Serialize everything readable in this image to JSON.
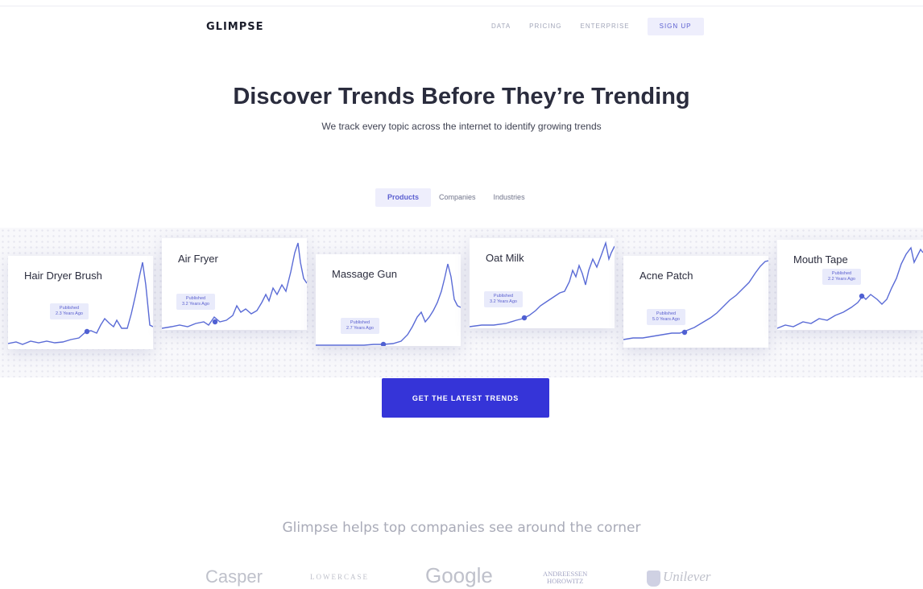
{
  "header": {
    "logo": "GLIMPSE",
    "nav": [
      "DATA",
      "PRICING",
      "ENTERPRISE"
    ],
    "signup_label": "SIGN UP"
  },
  "hero": {
    "title": "Discover Trends Before They’re Trending",
    "subtitle": "We track every topic across the internet to identify growing trends"
  },
  "tabs": {
    "items": [
      "Products",
      "Companies",
      "Industries"
    ],
    "active": "Products"
  },
  "cards": [
    {
      "name": "Hair Dryer Brush",
      "published_line1": "Published",
      "published_line2": "2.3 Years Ago"
    },
    {
      "name": "Air Fryer",
      "published_line1": "Published",
      "published_line2": "3.2 Years Ago"
    },
    {
      "name": "Massage Gun",
      "published_line1": "Published",
      "published_line2": "2.7 Years Ago"
    },
    {
      "name": "Oat Milk",
      "published_line1": "Published",
      "published_line2": "3.2 Years Ago"
    },
    {
      "name": "Acne Patch",
      "published_line1": "Published",
      "published_line2": "5.0 Years Ago"
    },
    {
      "name": "Mouth Tape",
      "published_line1": "Published",
      "published_line2": "2.2 Years Ago"
    }
  ],
  "cta_label": "GET THE LATEST TRENDS",
  "companies": {
    "title": "Glimpse helps top companies see around the corner",
    "logos": [
      "Casper",
      "LOWERCASE",
      "Google",
      "ANDREESSEN",
      "HOROWITZ",
      "Unilever"
    ]
  },
  "colors": {
    "accent": "#3534d8",
    "accent_soft": "#eeeefc",
    "chart_line": "#5a6bd6"
  },
  "icons": [
    "trend-line-icon",
    "unilever-logo-icon"
  ]
}
